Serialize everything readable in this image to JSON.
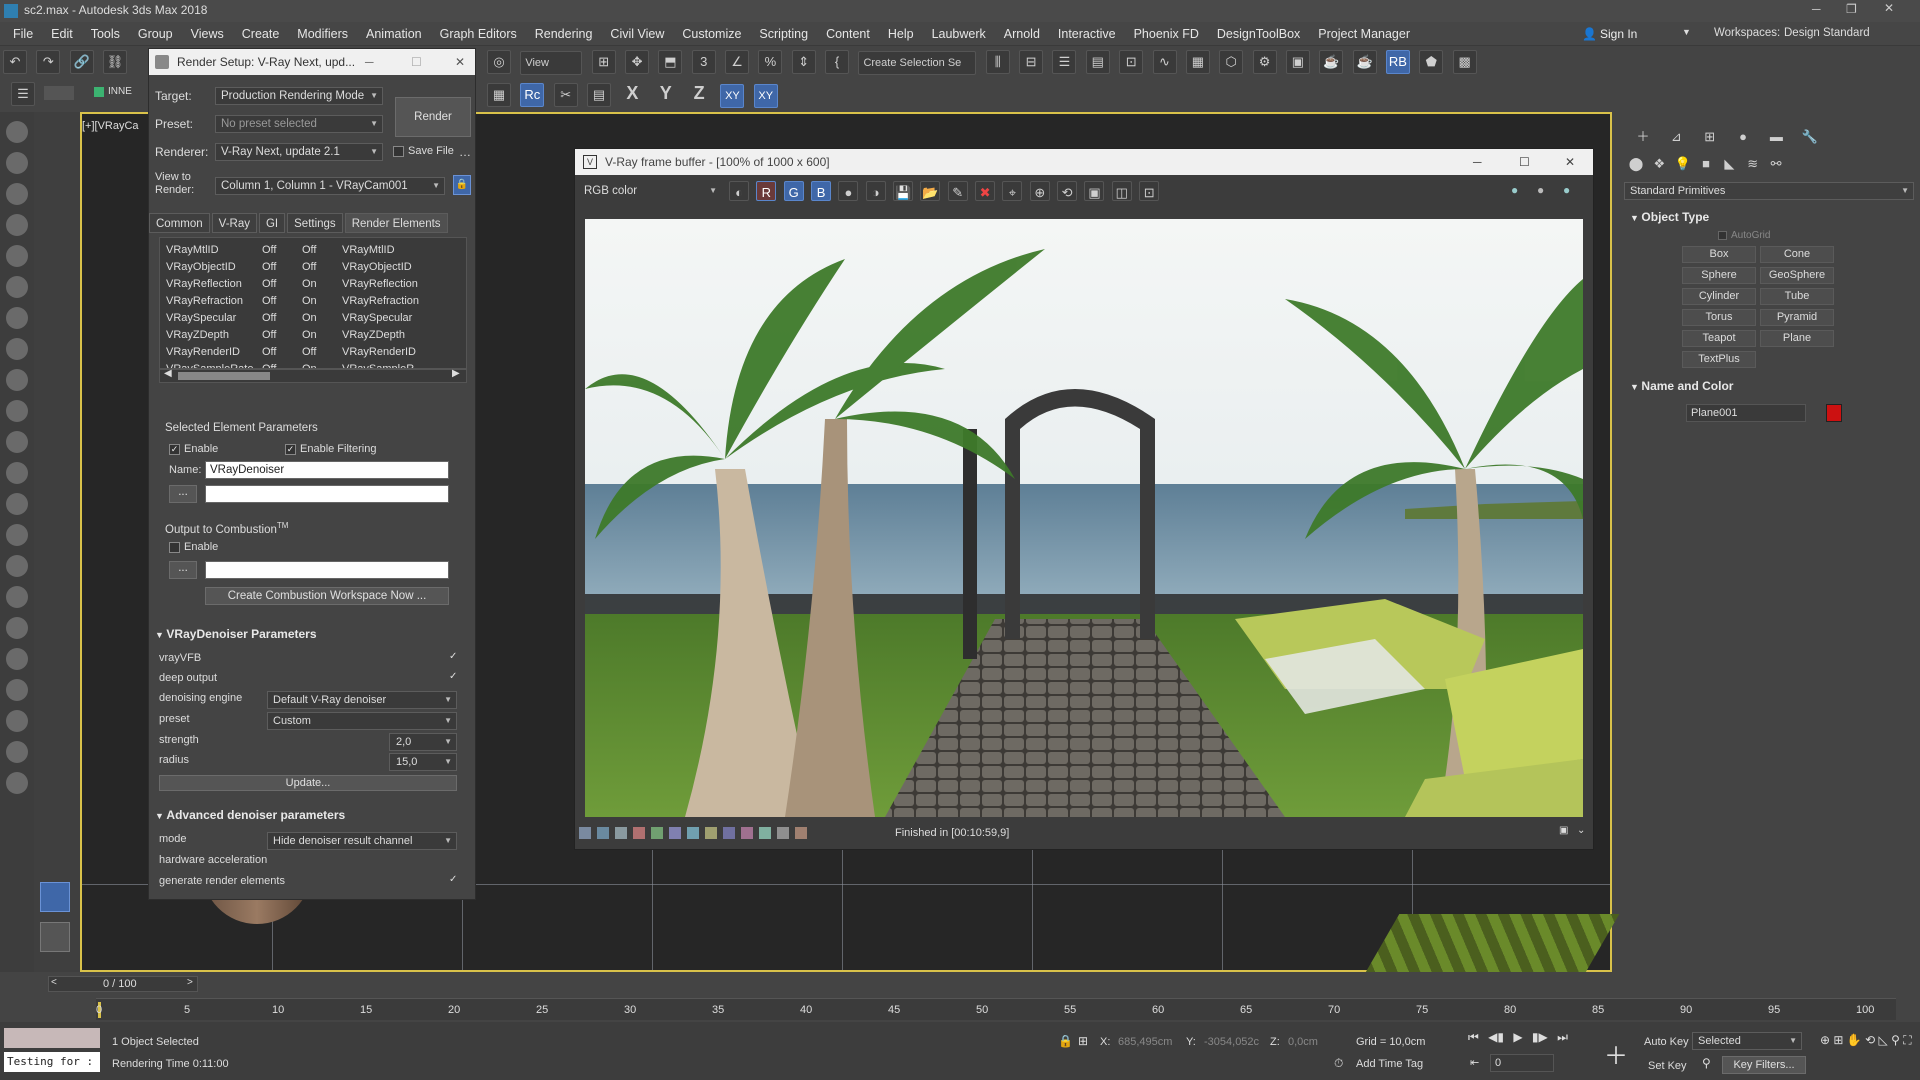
{
  "title": "sc2.max - Autodesk 3ds Max 2018",
  "menu": [
    "File",
    "Edit",
    "Tools",
    "Group",
    "Views",
    "Create",
    "Modifiers",
    "Animation",
    "Graph Editors",
    "Rendering",
    "Civil View",
    "Customize",
    "Scripting",
    "Content",
    "Help",
    "Laubwerk",
    "Arnold",
    "Interactive",
    "Phoenix FD",
    "DesignToolBox",
    "Project Manager"
  ],
  "account": {
    "sign_in": "Sign In",
    "workspaces_label": "Workspaces:",
    "workspace": "Design Standard"
  },
  "toolbar": {
    "view_dropdown": "View",
    "selection_set": "Create Selection Se",
    "axis_x": "X",
    "axis_y": "Y",
    "axis_z": "Z",
    "axis_xy": "XY",
    "axis_xy2": "XY",
    "inne": "INNE"
  },
  "viewport": {
    "label": "[+][VRayCa"
  },
  "render_setup": {
    "title": "Render Setup: V-Ray Next, upd...",
    "target_label": "Target:",
    "target": "Production Rendering Mode",
    "preset_label": "Preset:",
    "preset": "No preset selected",
    "renderer_label": "Renderer:",
    "renderer": "V-Ray Next, update 2.1",
    "save_file": "Save File",
    "view_label": "View to Render:",
    "view": "Column 1, Column 1 - VRayCam001",
    "render_button": "Render",
    "tabs": [
      "Common",
      "V-Ray",
      "GI",
      "Settings",
      "Render Elements"
    ],
    "elements": [
      {
        "name": "VRayMtlID",
        "a": "Off",
        "b": "Off",
        "c": "VRayMtlID"
      },
      {
        "name": "VRayObjectID",
        "a": "Off",
        "b": "Off",
        "c": "VRayObjectID"
      },
      {
        "name": "VRayReflection",
        "a": "Off",
        "b": "On",
        "c": "VRayReflection"
      },
      {
        "name": "VRayRefraction",
        "a": "Off",
        "b": "On",
        "c": "VRayRefraction"
      },
      {
        "name": "VRaySpecular",
        "a": "Off",
        "b": "On",
        "c": "VRaySpecular"
      },
      {
        "name": "VRayZDepth",
        "a": "Off",
        "b": "On",
        "c": "VRayZDepth"
      },
      {
        "name": "VRayRenderID",
        "a": "Off",
        "b": "Off",
        "c": "VRayRenderID"
      },
      {
        "name": "VRaySampleRate",
        "a": "Off",
        "b": "On",
        "c": "VRaySampleR..."
      }
    ],
    "sel_params_title": "Selected Element Parameters",
    "enable": "Enable",
    "enable_filtering": "Enable Filtering",
    "name_label": "Name:",
    "name_value": "VRayDenoiser",
    "dots": "...",
    "combustion_title": "Output to Combustion",
    "combustion_tm": "TM",
    "combustion_enable": "Enable",
    "combustion_button": "Create Combustion Workspace Now ...",
    "denoiser_title": "VRayDenoiser Parameters",
    "denoiser": {
      "vrayvfb": "vrayVFB",
      "deep_output": "deep output",
      "engine_label": "denoising engine",
      "engine": "Default V-Ray denoiser",
      "preset_label": "preset",
      "preset": "Custom",
      "strength_label": "strength",
      "strength": "2,0",
      "radius_label": "radius",
      "radius": "15,0",
      "update": "Update..."
    },
    "advanced_title": "Advanced denoiser parameters",
    "advanced": {
      "mode_label": "mode",
      "mode": "Hide denoiser result channel",
      "hw_label": "hardware acceleration",
      "gen_label": "generate render elements"
    }
  },
  "vfb": {
    "title": "V-Ray frame buffer - [100% of 1000 x 600]",
    "channel": "RGB color",
    "status": "Finished in [00:10:59,9]"
  },
  "command_panel": {
    "category": "Standard Primitives",
    "object_type": "Object Type",
    "autogrid": "AutoGrid",
    "primitives": [
      "Box",
      "Cone",
      "Sphere",
      "GeoSphere",
      "Cylinder",
      "Tube",
      "Torus",
      "Pyramid",
      "Teapot",
      "Plane",
      "TextPlus"
    ],
    "name_color": "Name and Color",
    "object_name": "Plane001",
    "object_color": "#cc1111"
  },
  "timeline": {
    "frame": "0 / 100",
    "ticks": [
      "0",
      "5",
      "10",
      "15",
      "20",
      "25",
      "30",
      "35",
      "40",
      "45",
      "50",
      "55",
      "60",
      "65",
      "70",
      "75",
      "80",
      "85",
      "90",
      "95",
      "100"
    ]
  },
  "status": {
    "selected": "1 Object Selected",
    "render_time": "Rendering Time  0:11:00",
    "script": "Testing for :",
    "x_label": "X:",
    "x": "685,495cm",
    "y_label": "Y:",
    "y": "-3054,052c",
    "z_label": "Z:",
    "z": "0,0cm",
    "grid": "Grid = 10,0cm",
    "add_time_tag": "Add Time Tag",
    "auto_key": "Auto Key",
    "set_key": "Set Key",
    "selected_dropdown": "Selected",
    "key_filters": "Key Filters...",
    "frame_field": "0"
  }
}
